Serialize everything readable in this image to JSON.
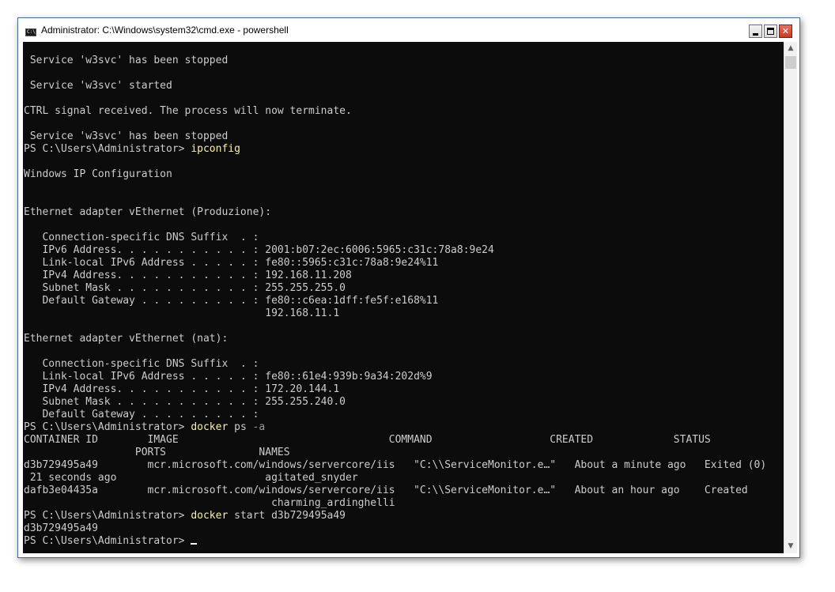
{
  "window": {
    "title": "Administrator: C:\\Windows\\system32\\cmd.exe - powershell",
    "app_icon_text": "C:\\",
    "minimize_symbol": "",
    "maximize_symbol": "",
    "close_symbol": "✕"
  },
  "colors": {
    "console_background": "#0c0c0c",
    "console_text": "#cccccc",
    "command_text": "#f9f1a5",
    "parameter_text": "#9a9a9a"
  },
  "console": {
    "prompt": "PS C:\\Users\\Administrator> ",
    "lines": [
      " Service 'w3svc' has been stopped",
      "",
      " Service 'w3svc' started",
      "",
      "CTRL signal received. The process will now terminate.",
      "",
      " Service 'w3svc' has been stopped",
      "__CMD1__",
      "",
      "Windows IP Configuration",
      "",
      "",
      "Ethernet adapter vEthernet (Produzione):",
      "",
      "   Connection-specific DNS Suffix  . :",
      "   IPv6 Address. . . . . . . . . . . : 2001:b07:2ec:6006:5965:c31c:78a8:9e24",
      "   Link-local IPv6 Address . . . . . : fe80::5965:c31c:78a8:9e24%11",
      "   IPv4 Address. . . . . . . . . . . : 192.168.11.208",
      "   Subnet Mask . . . . . . . . . . . : 255.255.255.0",
      "   Default Gateway . . . . . . . . . : fe80::c6ea:1dff:fe5f:e168%11",
      "                                       192.168.11.1",
      "",
      "Ethernet adapter vEthernet (nat):",
      "",
      "   Connection-specific DNS Suffix  . :",
      "   Link-local IPv6 Address . . . . . : fe80::61e4:939b:9a34:202d%9",
      "   IPv4 Address. . . . . . . . . . . : 172.20.144.1",
      "   Subnet Mask . . . . . . . . . . . : 255.255.240.0",
      "   Default Gateway . . . . . . . . . :",
      "__CMD2__",
      "CONTAINER ID        IMAGE                                  COMMAND                   CREATED             STATUS",
      "                  PORTS               NAMES",
      "d3b729495a49        mcr.microsoft.com/windows/servercore/iis   \"C:\\\\ServiceMonitor.e…\"   About a minute ago   Exited (0)",
      " 21 seconds ago                        agitated_snyder",
      "dafb3e04435a        mcr.microsoft.com/windows/servercore/iis   \"C:\\\\ServiceMonitor.e…\"   About an hour ago    Created",
      "                                        charming_ardinghelli",
      "__CMD3__",
      "d3b729495a49",
      "__CMD4__"
    ],
    "commands": {
      "ipconfig": {
        "cmd": "ipconfig",
        "args": ""
      },
      "docker_ps": {
        "cmd": "docker",
        "args": " ps",
        "param": " -a"
      },
      "docker_start": {
        "cmd": "docker",
        "args": " start d3b729495a49"
      }
    }
  }
}
